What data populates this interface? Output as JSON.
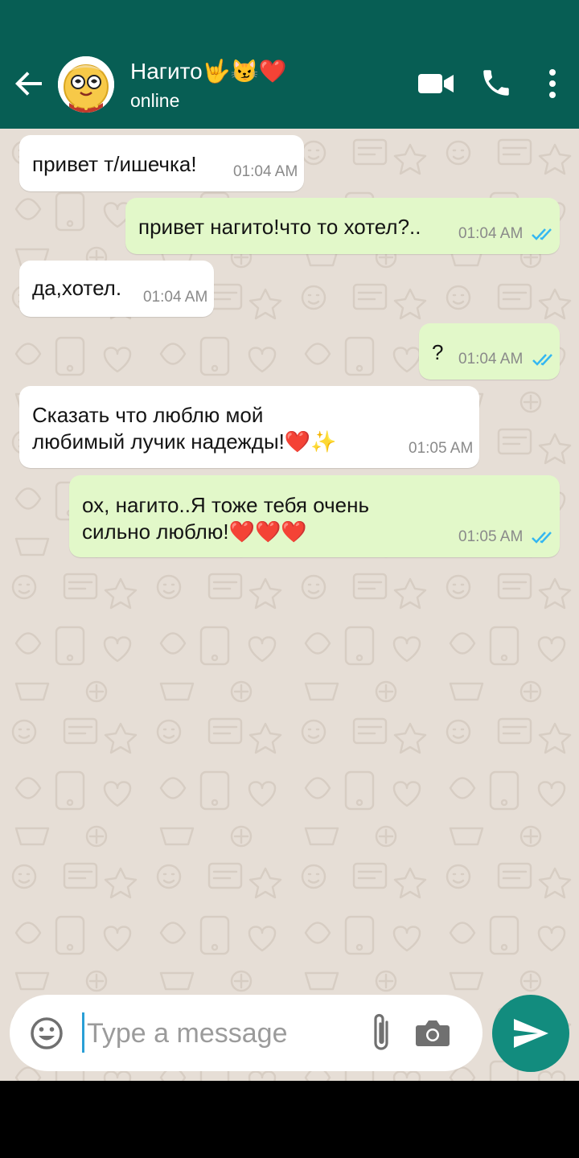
{
  "contact": {
    "name": "Нагито🤟😼❤️",
    "status": "online"
  },
  "icons": {
    "back": "arrow-back-icon",
    "video": "video-call-icon",
    "call": "phone-call-icon",
    "menu": "more-vert-icon",
    "emoji": "emoji-icon",
    "attach": "paperclip-icon",
    "camera": "camera-icon",
    "send": "send-icon",
    "read_receipt": "double-check-icon"
  },
  "colors": {
    "header": "#075e54",
    "incoming_bubble": "#ffffff",
    "outgoing_bubble": "#e2f8c9",
    "chat_background": "#e6ded6",
    "send_button": "#128c7e",
    "read_ticks": "#34b7f1"
  },
  "messages": [
    {
      "direction": "in",
      "text": "привет т/ишечка!",
      "time": "01:04 AM"
    },
    {
      "direction": "out",
      "text": "привет нагито!что то хотел?..",
      "time": "01:04 AM",
      "status": "read"
    },
    {
      "direction": "in",
      "text": "да,хотел.",
      "time": "01:04 AM"
    },
    {
      "direction": "out",
      "text": "?",
      "time": "01:04 AM",
      "status": "read"
    },
    {
      "direction": "in",
      "text": "Сказать что люблю мой\nлюбимый лучик надежды!❤️✨",
      "time": "01:05 AM"
    },
    {
      "direction": "out",
      "text": "ох, нагито..Я тоже тебя очень\nсильно люблю!❤️❤️❤️",
      "time": "01:05 AM",
      "status": "read"
    }
  ],
  "composer": {
    "placeholder": "Type a message",
    "value": ""
  }
}
